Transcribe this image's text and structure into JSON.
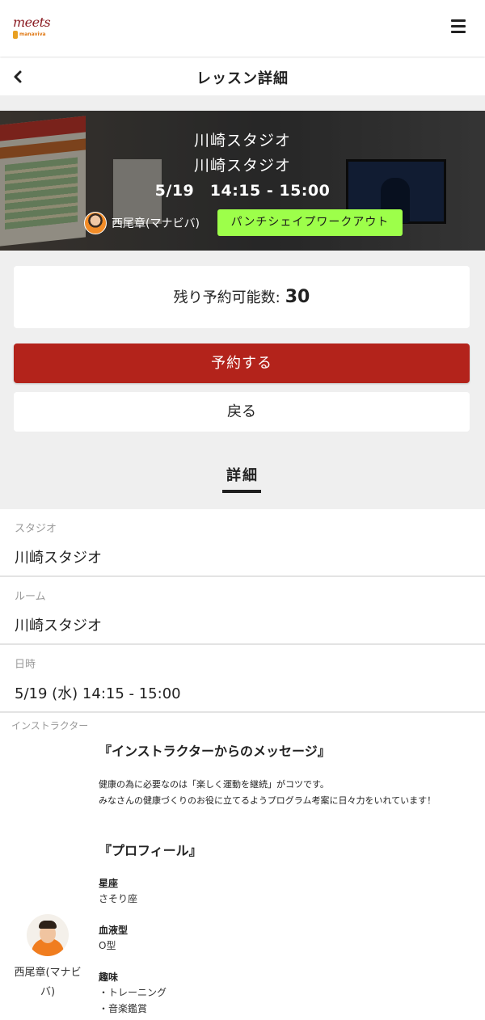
{
  "header": {
    "logo_text": "meets",
    "logo_sub": "manaviva",
    "menu_icon": "hamburger-menu-icon"
  },
  "subheader": {
    "back_icon": "chevron-left-icon",
    "title": "レッスン詳細"
  },
  "hero": {
    "studio_line1": "川崎スタジオ",
    "studio_line2": "川崎スタジオ",
    "datetime": "5/19　14:15 - 15:00",
    "instructor_name": "西尾章(マナビバ)",
    "program_tag": "パンチシェイプワークアウト",
    "tag_color": "#9dff4a"
  },
  "availability": {
    "label": "残り予約可能数:",
    "count": "30"
  },
  "actions": {
    "reserve_label": "予約する",
    "reserve_color": "#b3231b",
    "back_label": "戻る"
  },
  "details": {
    "tab_label": "詳細",
    "fields": [
      {
        "label": "スタジオ",
        "value": "川崎スタジオ"
      },
      {
        "label": "ルーム",
        "value": "川崎スタジオ"
      },
      {
        "label": "日時",
        "value": "5/19 (水) 14:15 - 15:00"
      }
    ]
  },
  "instructor": {
    "section_label": "インストラクター",
    "name": "西尾章(マナビバ)",
    "message_title": "『インストラクターからのメッセージ』",
    "message_lines": [
      "健康の為に必要なのは「楽しく運動を継続」がコツです。",
      "みなさんの健康づくりのお役に立てるようプログラム考案に日々力をいれています！"
    ],
    "profile_title": "『プロフィール』",
    "profile": [
      {
        "key": "星座",
        "values": [
          "さそり座"
        ]
      },
      {
        "key": "血液型",
        "values": [
          "O型"
        ]
      },
      {
        "key": "趣味",
        "values": [
          "・トレーニング",
          "・音楽鑑賞"
        ]
      }
    ]
  }
}
